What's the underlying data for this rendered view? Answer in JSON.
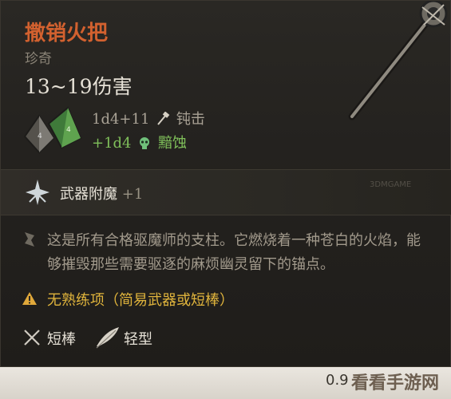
{
  "item": {
    "name": "撒销火把",
    "rarity": "珍奇",
    "damage_total": "13~19伤害",
    "damage_lines": [
      {
        "roll": "1d4+11",
        "type_icon": "bludgeon-icon",
        "type": "钝击",
        "color": "#a9a295"
      },
      {
        "roll": "+1d4",
        "type_icon": "necrotic-skull-icon",
        "type": "黯蚀",
        "color": "#7fbf5a"
      }
    ]
  },
  "enchantment": {
    "label": "武器附魔",
    "value": "+1"
  },
  "description": "这是所有合格驱魔师的支柱。它燃烧着一种苍白的火焰，能够摧毁那些需要驱逐的麻烦幽灵留下的锚点。",
  "warning": "无熟练项（简易武器或短棒）",
  "tags": [
    {
      "icon": "crossed-swords-icon",
      "label": "短棒"
    },
    {
      "icon": "feather-icon",
      "label": "轻型"
    }
  ],
  "footer": {
    "value": "0.9",
    "watermark": "看看手游网",
    "small_watermark": "3DMGAME"
  },
  "colors": {
    "name": "#d2612f",
    "necrotic": "#7fbf5a",
    "warning": "#e0b43c"
  }
}
